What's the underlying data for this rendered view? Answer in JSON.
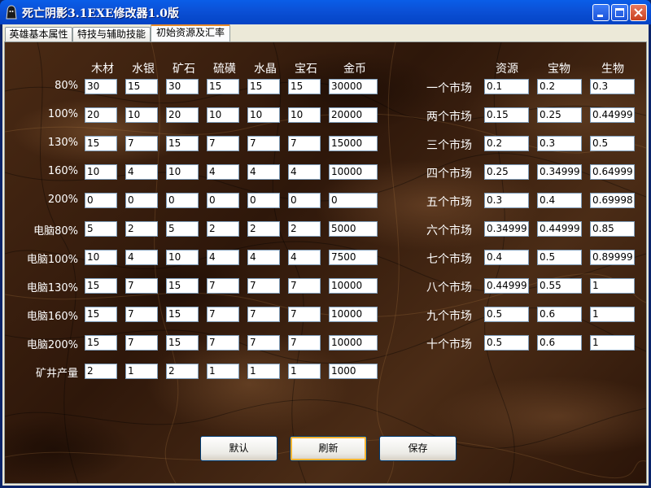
{
  "window": {
    "title": "死亡阴影3.1EXE修改器1.0版"
  },
  "tabs": [
    {
      "label": "英雄基本属性"
    },
    {
      "label": "特技与辅助技能"
    },
    {
      "label": "初始资源及汇率"
    }
  ],
  "resources": {
    "columns": [
      "木材",
      "水银",
      "矿石",
      "硫磺",
      "水晶",
      "宝石",
      "金币"
    ],
    "rows": [
      {
        "label": "80%",
        "values": [
          "30",
          "15",
          "30",
          "15",
          "15",
          "15",
          "30000"
        ]
      },
      {
        "label": "100%",
        "values": [
          "20",
          "10",
          "20",
          "10",
          "10",
          "10",
          "20000"
        ]
      },
      {
        "label": "130%",
        "values": [
          "15",
          "7",
          "15",
          "7",
          "7",
          "7",
          "15000"
        ]
      },
      {
        "label": "160%",
        "values": [
          "10",
          "4",
          "10",
          "4",
          "4",
          "4",
          "10000"
        ]
      },
      {
        "label": "200%",
        "values": [
          "0",
          "0",
          "0",
          "0",
          "0",
          "0",
          "0"
        ]
      },
      {
        "label": "电脑80%",
        "values": [
          "5",
          "2",
          "5",
          "2",
          "2",
          "2",
          "5000"
        ]
      },
      {
        "label": "电脑100%",
        "values": [
          "10",
          "4",
          "10",
          "4",
          "4",
          "4",
          "7500"
        ]
      },
      {
        "label": "电脑130%",
        "values": [
          "15",
          "7",
          "15",
          "7",
          "7",
          "7",
          "10000"
        ]
      },
      {
        "label": "电脑160%",
        "values": [
          "15",
          "7",
          "15",
          "7",
          "7",
          "7",
          "10000"
        ]
      },
      {
        "label": "电脑200%",
        "values": [
          "15",
          "7",
          "15",
          "7",
          "7",
          "7",
          "10000"
        ]
      },
      {
        "label": "矿井产量",
        "values": [
          "2",
          "1",
          "2",
          "1",
          "1",
          "1",
          "1000"
        ]
      }
    ]
  },
  "market": {
    "columns": [
      "资源",
      "宝物",
      "生物"
    ],
    "rows": [
      {
        "label": "一个市场",
        "values": [
          "0.1",
          "0.2",
          "0.3"
        ]
      },
      {
        "label": "两个市场",
        "values": [
          "0.15",
          "0.25",
          "0.44999"
        ]
      },
      {
        "label": "三个市场",
        "values": [
          "0.2",
          "0.3",
          "0.5"
        ]
      },
      {
        "label": "四个市场",
        "values": [
          "0.25",
          "0.34999",
          "0.64999"
        ]
      },
      {
        "label": "五个市场",
        "values": [
          "0.3",
          "0.4",
          "0.69998"
        ]
      },
      {
        "label": "六个市场",
        "values": [
          "0.34999",
          "0.44999",
          "0.85"
        ]
      },
      {
        "label": "七个市场",
        "values": [
          "0.4",
          "0.5",
          "0.89999"
        ]
      },
      {
        "label": "八个市场",
        "values": [
          "0.44999",
          "0.55",
          "1"
        ]
      },
      {
        "label": "九个市场",
        "values": [
          "0.5",
          "0.6",
          "1"
        ]
      },
      {
        "label": "十个市场",
        "values": [
          "0.5",
          "0.6",
          "1"
        ]
      }
    ]
  },
  "buttons": {
    "default_label": "默认",
    "refresh_label": "刷新",
    "save_label": "保存"
  },
  "colors": {
    "titlebar": "#0b50d6",
    "panel_bg": "#3a2110",
    "tab_highlight": "#e68b2c"
  }
}
